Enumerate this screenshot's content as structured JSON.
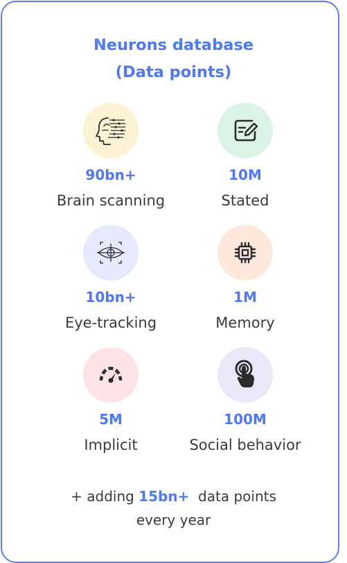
{
  "card": {
    "title_line1": "Neurons database",
    "title_line2": "(Data points)",
    "colors": {
      "accent": "#4f78f4",
      "border": "#5b7ff0",
      "text": "#3a3a3a"
    },
    "stats": [
      {
        "value": "90bn+",
        "label": "Brain scanning",
        "icon": "brain-scan-icon",
        "bg": "#fdf2d3"
      },
      {
        "value": "10M",
        "label": "Stated",
        "icon": "edit-form-icon",
        "bg": "#daf3e6"
      },
      {
        "value": "10bn+",
        "label": "Eye-tracking",
        "icon": "eye-target-icon",
        "bg": "#e6e9fb"
      },
      {
        "value": "1M",
        "label": "Memory",
        "icon": "chip-icon",
        "bg": "#fde8db"
      },
      {
        "value": "5M",
        "label": "Implicit",
        "icon": "speedometer-icon",
        "bg": "#fde3e6"
      },
      {
        "value": "100M",
        "label": "Social behavior",
        "icon": "tap-gesture-icon",
        "bg": "#ece6fb"
      }
    ],
    "footer": {
      "prefix": "+ adding ",
      "highlight": "15bn+",
      "suffix": "  data points",
      "line2": "every year"
    }
  }
}
